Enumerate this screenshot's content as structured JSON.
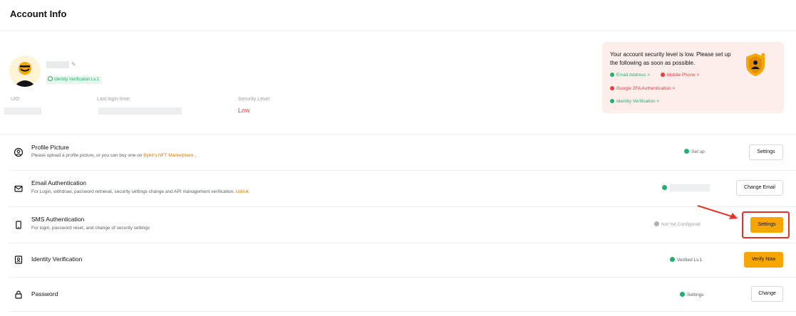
{
  "header": {
    "title": "Account Info"
  },
  "profile": {
    "identity_badge": "Identity Verification Lv.1",
    "uid_label": "UID",
    "last_login_label": "Last login time:",
    "security_level_label": "Security Level:",
    "security_level_value": "Low"
  },
  "alert": {
    "message": "Your account security level is low. Please set up the following as soon as possible.",
    "items": [
      {
        "label": "Email Address >",
        "state": "ok"
      },
      {
        "label": "Mobile Phone >",
        "state": "missing"
      },
      {
        "label": "Google 2FA Authentication >",
        "state": "missing"
      },
      {
        "label": "Identity Verification >",
        "state": "ok"
      }
    ]
  },
  "rows": {
    "profile_picture": {
      "title": "Profile Picture",
      "desc": "Please upload a profile picture, or you can buy one on",
      "link": "Bybit's NFT Marketplace",
      "desc_end": ".",
      "status": "Set up",
      "button": "Settings"
    },
    "email": {
      "title": "Email Authentication",
      "desc": "For Login, withdraw, password retrieval, security settings change and API management verification.",
      "link": "Unlink",
      "button": "Change Email"
    },
    "sms": {
      "title": "SMS Authentication",
      "desc": "For login, password reset, and change of security settings",
      "status": "Not Yet Configured",
      "button": "Settings"
    },
    "identity": {
      "title": "Identity Verification",
      "status": "Verified Lv.1",
      "button": "Verify Now"
    },
    "password": {
      "title": "Password",
      "status": "Settings",
      "button": "Change"
    }
  },
  "colors": {
    "accent": "#f7a600",
    "success": "#20b26c",
    "danger": "#f23b3b",
    "link": "#e07a00",
    "highlight": "#e5332a"
  }
}
